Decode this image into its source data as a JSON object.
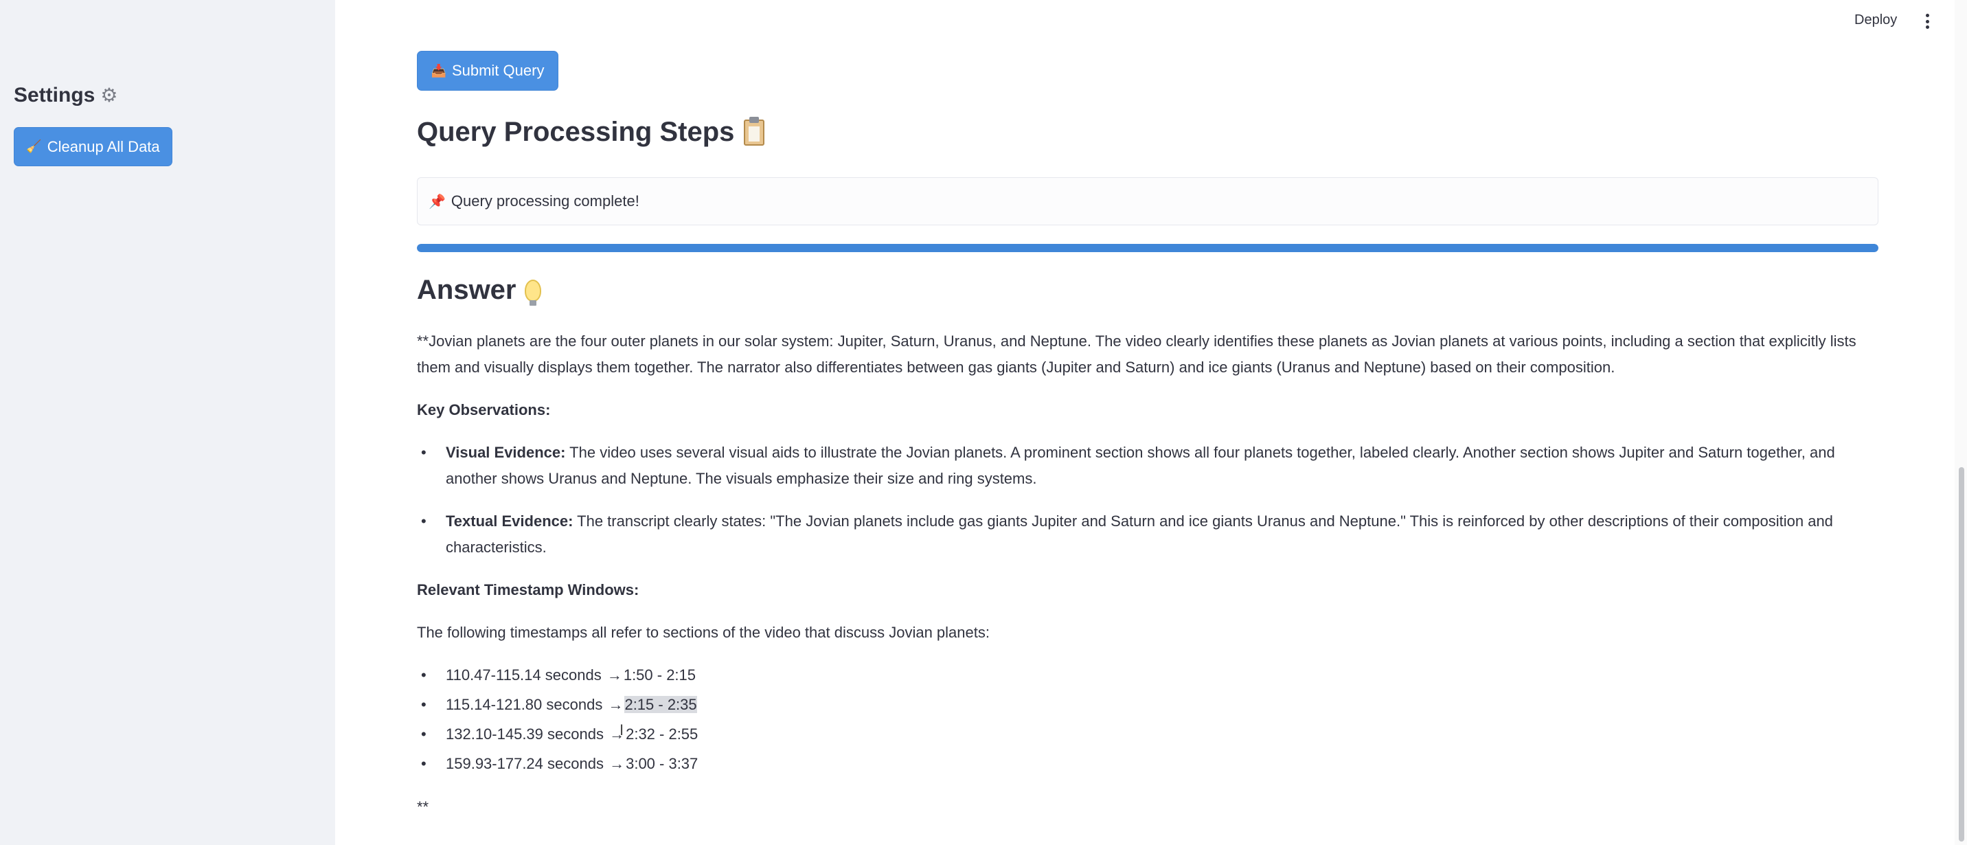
{
  "sidebar": {
    "title": "Settings",
    "cleanup_label": "Cleanup All Data"
  },
  "header": {
    "deploy_label": "Deploy"
  },
  "main": {
    "submit_label": "Submit Query",
    "steps_heading": "Query Processing Steps",
    "status_text": "Query processing complete!",
    "progress_fraction": 1.0,
    "answer_heading": "Answer",
    "answer_intro": "**Jovian planets are the four outer planets in our solar system: Jupiter, Saturn, Uranus, and Neptune. The video clearly identifies these planets as Jovian planets at various points, including a section that explicitly lists them and visually displays them together. The narrator also differentiates between gas giants (Jupiter and Saturn) and ice giants (Uranus and Neptune) based on their composition.",
    "key_obs_heading": "Key Observations:",
    "observations": [
      {
        "label": "Visual Evidence:",
        "text": " The video uses several visual aids to illustrate the Jovian planets. A prominent section shows all four planets together, labeled clearly. Another section shows Jupiter and Saturn together, and another shows Uranus and Neptune. The visuals emphasize their size and ring systems."
      },
      {
        "label": "Textual Evidence:",
        "text": " The transcript clearly states: \"The Jovian planets include gas giants Jupiter and Saturn and ice giants Uranus and Neptune.\" This is reinforced by other descriptions of their composition and characteristics."
      }
    ],
    "ts_heading": "Relevant Timestamp Windows:",
    "ts_intro": "The following timestamps all refer to sections of the video that discuss Jovian planets:",
    "timestamps": [
      {
        "seconds": "110.47-115.14 seconds",
        "range": "1:50 - 2:15"
      },
      {
        "seconds": "115.14-121.80 seconds",
        "range": "2:15 - 2:35"
      },
      {
        "seconds": "132.10-145.39 seconds",
        "range": "2:32 - 2:55"
      },
      {
        "seconds": "159.93-177.24 seconds",
        "range": "3:00 - 3:37"
      }
    ],
    "arrow": "→",
    "closing": "**"
  },
  "colors": {
    "accent": "#4a90e2",
    "sidebar_bg": "#f0f2f6",
    "text": "#31333f"
  }
}
